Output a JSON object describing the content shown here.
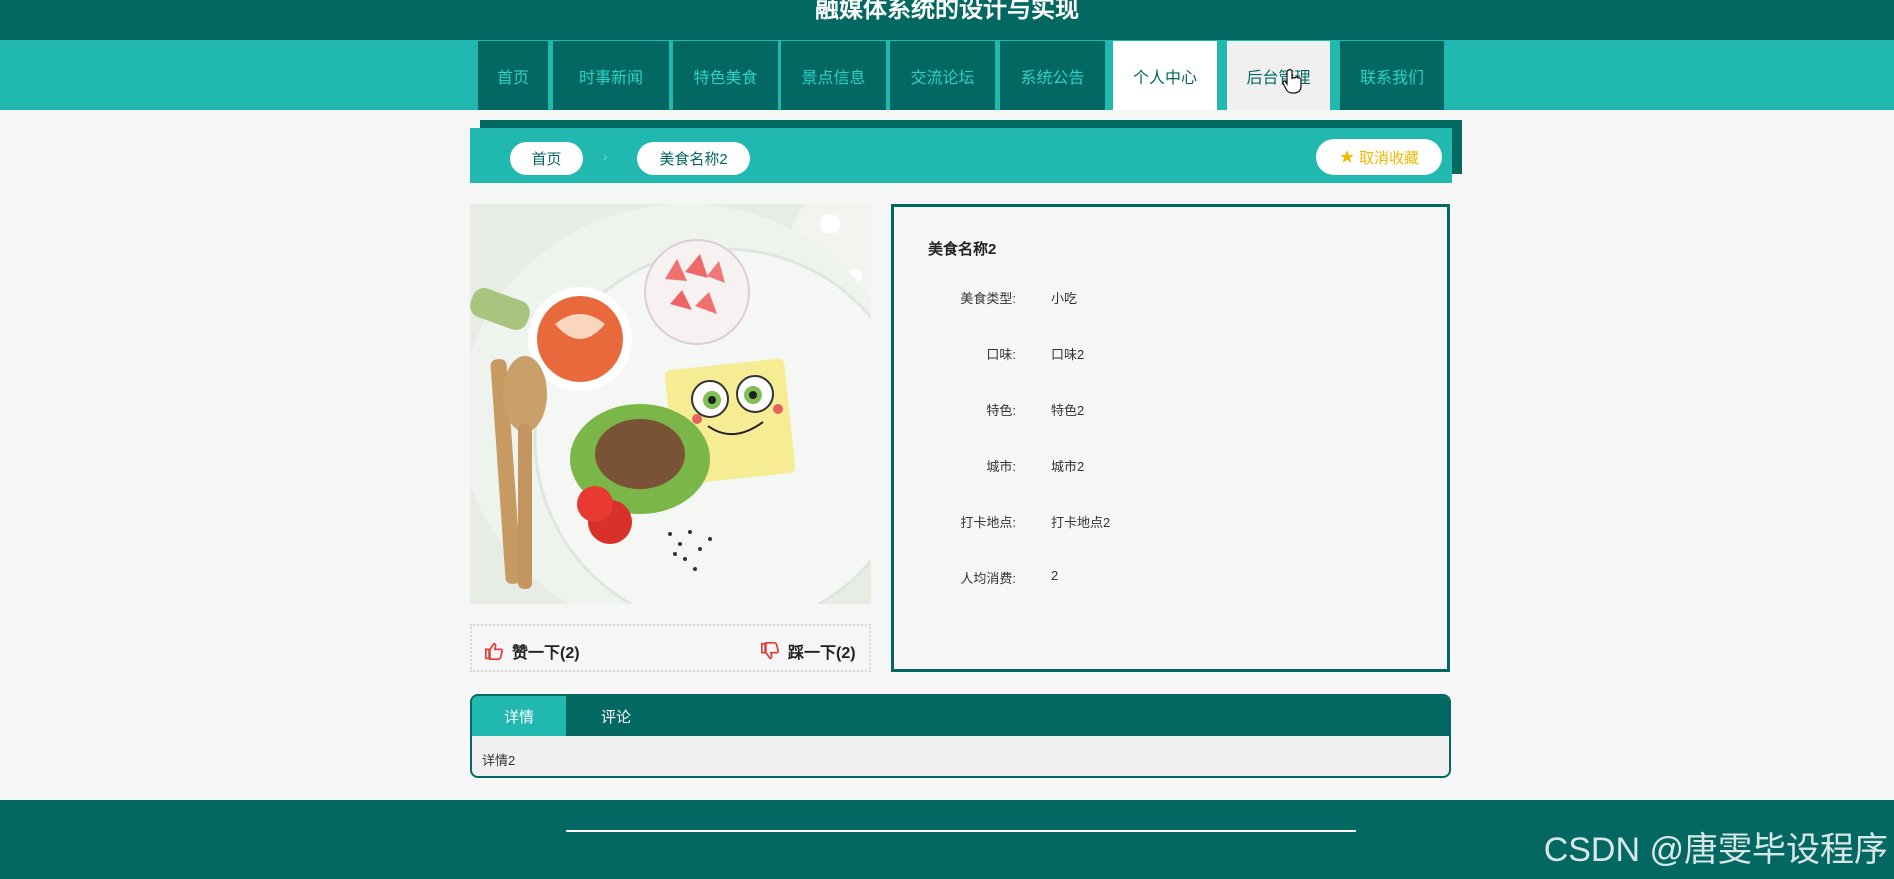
{
  "site": {
    "title": "融媒体系统的设计与实现"
  },
  "nav": {
    "items": [
      {
        "label": "首页"
      },
      {
        "label": "时事新闻"
      },
      {
        "label": "特色美食"
      },
      {
        "label": "景点信息"
      },
      {
        "label": "交流论坛"
      },
      {
        "label": "系统公告"
      },
      {
        "label": "个人中心"
      },
      {
        "label": "后台管理"
      },
      {
        "label": "联系我们"
      }
    ]
  },
  "breadcrumb": {
    "home": "首页",
    "current": "美食名称2"
  },
  "favorite": {
    "label": "取消收藏"
  },
  "votes": {
    "like": "赞一下(2)",
    "dislike": "踩一下(2)"
  },
  "detail": {
    "name": "美食名称2",
    "fields": [
      {
        "label": "美食类型:",
        "value": "小吃"
      },
      {
        "label": "口味:",
        "value": "口味2"
      },
      {
        "label": "特色:",
        "value": "特色2"
      },
      {
        "label": "城市:",
        "value": "城市2"
      },
      {
        "label": "打卡地点:",
        "value": "打卡地点2"
      },
      {
        "label": "人均消费:",
        "value": "2"
      }
    ]
  },
  "tabs": {
    "items": [
      {
        "label": "详情"
      },
      {
        "label": "评论"
      }
    ],
    "content": "详情2"
  },
  "watermark": "CSDN @唐雯毕设程序",
  "colors": {
    "primary_dark": "#036862",
    "primary_light": "#21b8b0",
    "accent_star": "#f2b800",
    "vote_icon": "#e53935"
  }
}
